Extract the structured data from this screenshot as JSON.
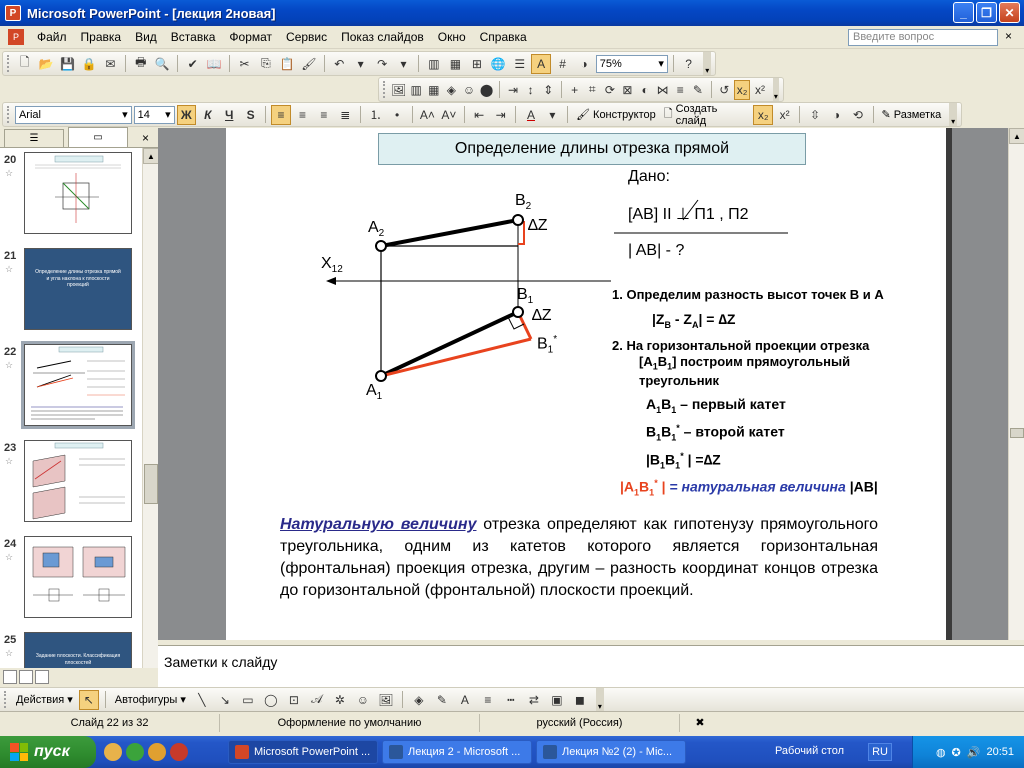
{
  "window": {
    "title": "Microsoft PowerPoint - [лекция 2новая]"
  },
  "menu": {
    "items": [
      "Файл",
      "Правка",
      "Вид",
      "Вставка",
      "Формат",
      "Сервис",
      "Показ слайдов",
      "Окно",
      "Справка"
    ],
    "help_placeholder": "Введите вопрос",
    "close": "×"
  },
  "toolbar_standard": {
    "zoom": "75%"
  },
  "toolbar_formatting": {
    "font": "Arial",
    "size": "14",
    "bold": "Ж",
    "italic": "К",
    "underline": "Ч",
    "shadow": "S",
    "designer": "Конструктор",
    "new_slide": "Создать слайд",
    "markup": "Разметка"
  },
  "left_panel": {
    "close": "×",
    "thumbs": [
      {
        "num": "20",
        "style": "diagram",
        "text": ""
      },
      {
        "num": "21",
        "style": "blue",
        "text": "Определение длины отрезка прямой и угла наклона к плоскости проекций"
      },
      {
        "num": "22",
        "style": "current",
        "text": ""
      },
      {
        "num": "23",
        "style": "diagram",
        "text": ""
      },
      {
        "num": "24",
        "style": "diagram",
        "text": ""
      },
      {
        "num": "25",
        "style": "blue",
        "text": "Задание плоскости. Классификация плоскостей"
      }
    ]
  },
  "slide": {
    "title": "Определение длины отрезка прямой",
    "labels": {
      "a2": "A",
      "a2_sub": "2",
      "b2": "B",
      "b2_sub": "2",
      "dz_top": "∆Z",
      "x12": "X",
      "x12_sub": "12",
      "b1": "B",
      "b1_sub": "1",
      "dz_mid": "∆Z",
      "b1star": "B",
      "b1star_sub": "1",
      "b1star_sup": "*",
      "a1": "A",
      "a1_sub": "1"
    },
    "given": {
      "label": "Дано:",
      "condition": "[AB] II ⊥ П1 , П2",
      "find": "| AB| - ?"
    },
    "steps": {
      "step1": "1. Определим разность высот точек B и A",
      "step1_formula": "|Z",
      "step1_formula_b": "B",
      "step1_formula_mid": " - Z",
      "step1_formula_a": "A",
      "step1_formula_end": "| = ∆Z",
      "step2_line1": "2. На горизонтальной проекции отрезка",
      "step2_line2_a": "[A",
      "step2_line2_b": "1",
      "step2_line2_c": "B",
      "step2_line2_d": "1",
      "step2_line2_e": "] построим прямоугольный",
      "step2_line3": "треугольник",
      "cathetus1_a": "A",
      "cathetus1_s1": "1",
      "cathetus1_b": "B",
      "cathetus1_s2": "1",
      "cathetus1_text": " – первый катет",
      "cathetus2_a": "B",
      "cathetus2_s1": "1",
      "cathetus2_b": "B",
      "cathetus2_s2": "1",
      "cathetus2_sup": "*",
      "cathetus2_text": " – второй катет",
      "eq_a": "|B",
      "eq_s1": "1",
      "eq_b": "B",
      "eq_s2": "1",
      "eq_sup": "*",
      "eq_end": " |  =∆Z",
      "result_a": "|A",
      "result_s1": "1",
      "result_b": "B",
      "result_s2": "1",
      "result_sup": "*",
      "result_bar": " |",
      "result_mid": "  = ",
      "result_text": "натуральная величина",
      "result_end": " |AB|"
    },
    "paragraph_lead": "Натуральную величину",
    "paragraph_rest": " отрезка определяют как гипотенузу прямоугольного треугольника, одним из катетов которого является горизонтальная (фронтальная) проекция отрезка, другим – разность координат концов отрезка до горизонтальной (фронтальной) плоскости проекций."
  },
  "notes": {
    "placeholder": "Заметки к слайду"
  },
  "drawing_toolbar": {
    "actions": "Действия",
    "autoshapes": "Автофигуры"
  },
  "status": {
    "slide": "Слайд 22 из 32",
    "design": "Оформление по умолчанию",
    "language": "русский (Россия)"
  },
  "taskbar": {
    "start": "пуск",
    "tasks": [
      "Microsoft PowerPoint ...",
      "Лекция 2 - Microsoft ...",
      "Лекция №2 (2) - Mic..."
    ],
    "desktop": "Рабочий стол",
    "lang": "RU",
    "clock": "20:51"
  },
  "colors": {
    "accent_red": "#e8431e",
    "accent_blue": "#2a3aa8",
    "title_box": "#dff0f2"
  }
}
